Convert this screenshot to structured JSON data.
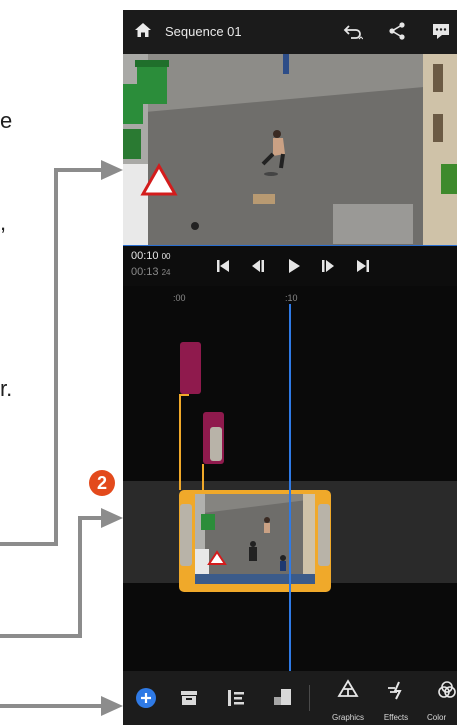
{
  "doc": {
    "fragment_e": "e",
    "fragment_comma": ",",
    "fragment_r": "r.",
    "badge_number": "2"
  },
  "app": {
    "sequence_title": "Sequence 01",
    "icons": [
      "home-icon",
      "undo-icon",
      "share-icon",
      "feedback-icon",
      "go-to-start-icon",
      "step-back-icon",
      "play-icon",
      "step-forward-icon",
      "go-to-end-icon",
      "add-icon",
      "media-icon",
      "tracks-icon",
      "crop-icon",
      "graphics-icon",
      "effects-icon",
      "color-icon"
    ]
  },
  "playback": {
    "current_time": "00:10",
    "current_frames": "00",
    "duration_time": "00:13",
    "duration_frames": "24"
  },
  "timeline": {
    "ruler_start": ":00",
    "ruler_mark": ":10"
  },
  "bottom_bar": {
    "graphics_label": "Graphics",
    "effects_label": "Effects",
    "color_label": "Color"
  },
  "colors": {
    "accent_blue": "#2f7ae5",
    "clip_border": "#f0a92a",
    "title_clip": "#8f1a4d",
    "badge": "#e34a1c"
  }
}
